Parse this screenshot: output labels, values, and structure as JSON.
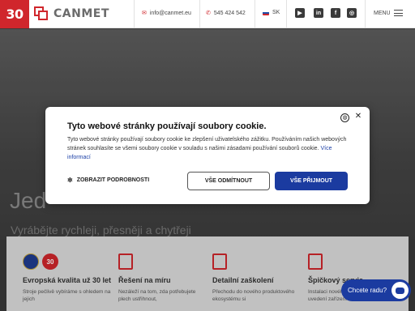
{
  "header": {
    "logo_badge": "30",
    "logo_text": "CANMET",
    "email": "info@canmet.eu",
    "phone": "545 424 542",
    "language": "SK",
    "social": [
      {
        "icon": "youtube-icon",
        "glyph": "▶"
      },
      {
        "icon": "linkedin-icon",
        "glyph": "in"
      },
      {
        "icon": "facebook-icon",
        "glyph": "f"
      },
      {
        "icon": "instagram-icon",
        "glyph": "◎"
      }
    ],
    "menu_label": "MENU"
  },
  "hero": {
    "title": "Jed",
    "subtitle": "Vyrábějte rychleji, přesněji a chytřeji"
  },
  "features": [
    {
      "title": "Evropská kvalita už 30 let",
      "text": "Stroje pečlivě vybíráme s ohledem na jejich"
    },
    {
      "title": "Řešení na míru",
      "text": "Nezáleží na tom, zda potřebujete plech ustřihnout,"
    },
    {
      "title": "Detailní zaškolení",
      "text": "Přechodu do nového produktového ekosystému si"
    },
    {
      "title": "Špičkový servis",
      "text": "Instalaci nového stroje nekončíme. Po uvedení zařízení"
    }
  ],
  "cookie": {
    "title": "Tyto webové stránky používají soubory cookie.",
    "text": "Tyto webové stránky používají soubory cookie ke zlepšení uživatelského zážitku. Používáním našich webových stránek souhlasíte se všemi soubory cookie v souladu s našimi zásadami používání souborů cookie.",
    "link": "Více informací",
    "details_label": "ZOBRAZIT PODROBNOSTI",
    "reject_label": "VŠE ODMÍTNOUT",
    "accept_label": "VŠE PŘIJMOUT"
  },
  "chat": {
    "label": "Chcete radu?"
  },
  "colors": {
    "brand_red": "#d0262c",
    "accent_blue": "#1b3ba0"
  }
}
